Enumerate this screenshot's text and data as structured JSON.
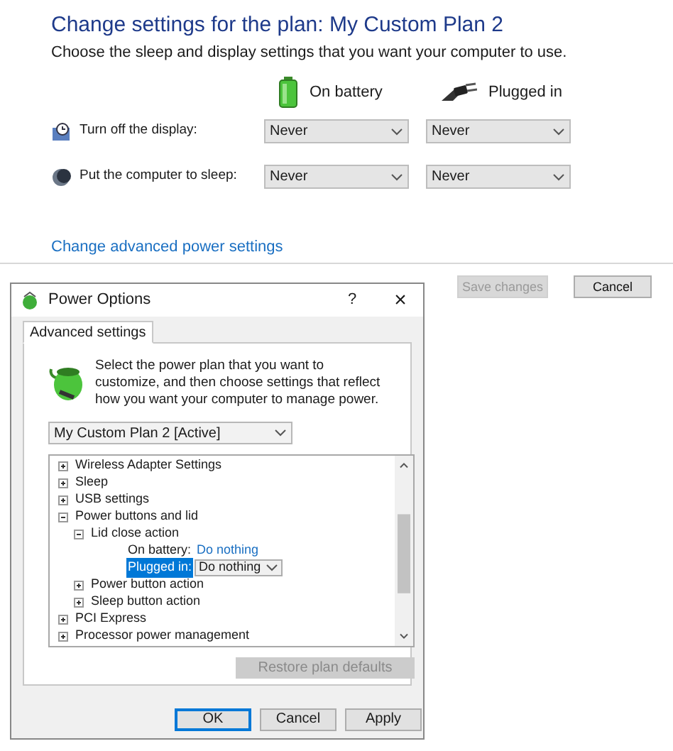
{
  "page": {
    "title": "Change settings for the plan: My Custom Plan 2",
    "subtitle": "Choose the sleep and display settings that you want your computer to use.",
    "columns": [
      "On battery",
      "Plugged in"
    ],
    "rows": [
      {
        "kind": "display",
        "label": "Turn off the display:",
        "values": [
          "Never",
          "Never"
        ]
      },
      {
        "kind": "sleep",
        "label": "Put the computer to sleep:",
        "values": [
          "Never",
          "Never"
        ]
      }
    ],
    "advanced_link": "Change advanced power settings",
    "buttons": [
      {
        "label": "Save changes",
        "disabled": true
      },
      {
        "label": "Cancel",
        "disabled": false
      }
    ]
  },
  "dialog": {
    "title": "Power Options",
    "help": "?",
    "close": "×",
    "tabs": [
      {
        "label": "Advanced settings",
        "selected": true
      }
    ],
    "intro": "Select the power plan that you want to customize, and then choose settings that reflect how you want your computer to manage power.",
    "plan": "My Custom Plan 2 [Active]",
    "tree": [
      {
        "label": "Wireless Adapter Settings",
        "expanded": false
      },
      {
        "label": "Sleep",
        "expanded": false
      },
      {
        "label": "USB settings",
        "expanded": false
      },
      {
        "label": "Power buttons and lid",
        "expanded": true,
        "children": [
          {
            "label": "Lid close action",
            "expanded": true,
            "children": [
              {
                "kind": "setting",
                "label": "On battery:",
                "value": "Do nothing",
                "selected": false
              },
              {
                "kind": "setting",
                "label": "Plugged in:",
                "value": "Do nothing",
                "selected": true
              }
            ]
          },
          {
            "label": "Power button action",
            "expanded": false
          },
          {
            "label": "Sleep button action",
            "expanded": false
          }
        ]
      },
      {
        "label": "PCI Express",
        "expanded": false
      },
      {
        "label": "Processor power management",
        "expanded": false
      }
    ],
    "restore": "Restore plan defaults",
    "buttons": [
      {
        "label": "OK",
        "default": true
      },
      {
        "label": "Cancel",
        "default": false
      },
      {
        "label": "Apply",
        "default": false
      }
    ]
  }
}
